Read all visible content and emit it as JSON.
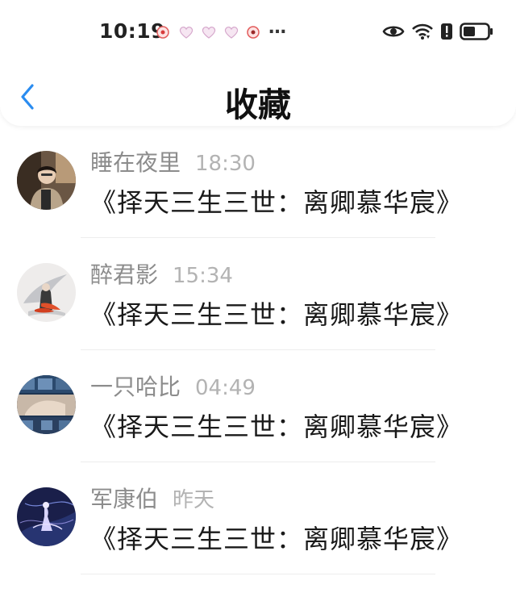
{
  "status_bar": {
    "time": "10:19",
    "notification_icons": [
      "music-red-icon",
      "heart-icon",
      "heart-icon",
      "heart-icon",
      "music-red-icon"
    ],
    "more": "…",
    "right_icons": [
      "eye-icon",
      "wifi-icon",
      "battery-alert-icon",
      "battery-icon"
    ]
  },
  "header": {
    "back_icon": "chevron-left-icon",
    "title": "收藏"
  },
  "colors": {
    "accent": "#2a8cf0",
    "name_text": "#8c8c8c",
    "time_text": "#b3b3b3",
    "content_text": "#1a1a1a"
  },
  "favorites": [
    {
      "name": "睡在夜里",
      "time": "18:30",
      "content": "《择天三生三世：离卿慕华宸》"
    },
    {
      "name": "醉君影",
      "time": "15:34",
      "content": "《择天三生三世：离卿慕华宸》"
    },
    {
      "name": "一只哈比",
      "time": "04:49",
      "content": "《择天三生三世：离卿慕华宸》"
    },
    {
      "name": "军康伯",
      "time": "昨天",
      "content": "《择天三生三世：离卿慕华宸》"
    }
  ]
}
